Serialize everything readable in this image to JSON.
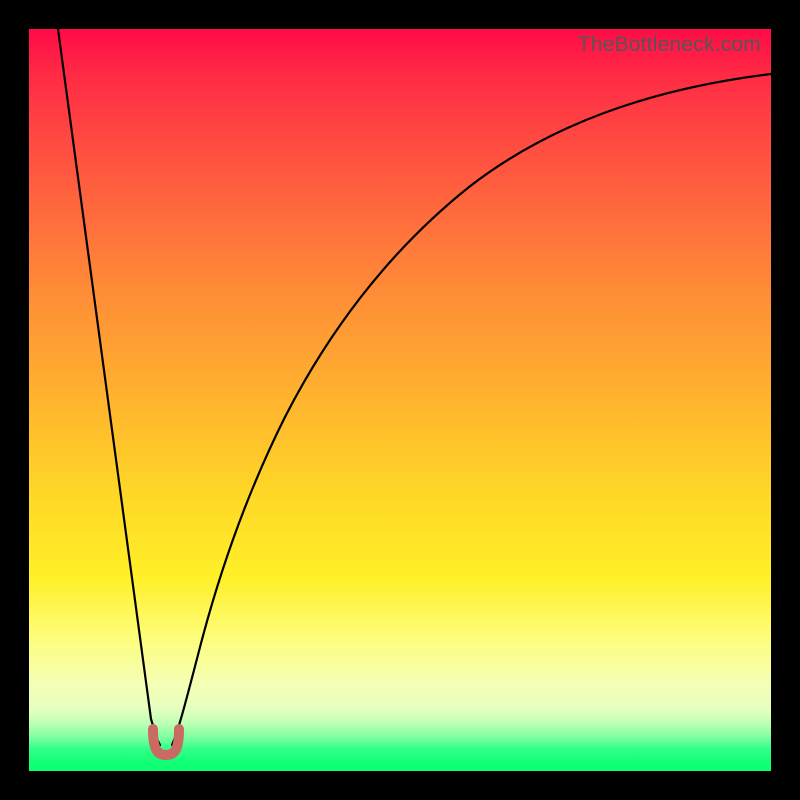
{
  "attribution": "TheBottleneck.com",
  "colors": {
    "frame": "#000000",
    "gradient_top": "#ff0b46",
    "gradient_mid": "#ffd827",
    "gradient_bottom": "#0fff75",
    "curve": "#000000",
    "marker": "#cb6a62"
  },
  "chart_data": {
    "type": "line",
    "title": "",
    "xlabel": "",
    "ylabel": "",
    "xlim": [
      0,
      100
    ],
    "ylim": [
      0,
      100
    ],
    "annotations": [],
    "series": [
      {
        "name": "bottleneck-curve",
        "x": [
          4,
          6,
          8,
          10,
          12,
          14,
          15,
          16,
          17,
          18,
          19,
          20,
          22,
          25,
          30,
          35,
          40,
          50,
          60,
          70,
          80,
          90,
          100
        ],
        "values": [
          100,
          85,
          71,
          57,
          43,
          28,
          20,
          12,
          6,
          3,
          3,
          6,
          15,
          27,
          42,
          52,
          60,
          71,
          79,
          84,
          88,
          90.5,
          92.5
        ]
      }
    ],
    "marker": {
      "name": "optimal-point",
      "x_range": [
        16.3,
        18.7
      ],
      "y": 3,
      "shape": "u"
    },
    "notes": "y-axis is inverted visually (0 at bottom = green/optimal, 100 at top = red/worst). Background color encodes the same scale."
  }
}
